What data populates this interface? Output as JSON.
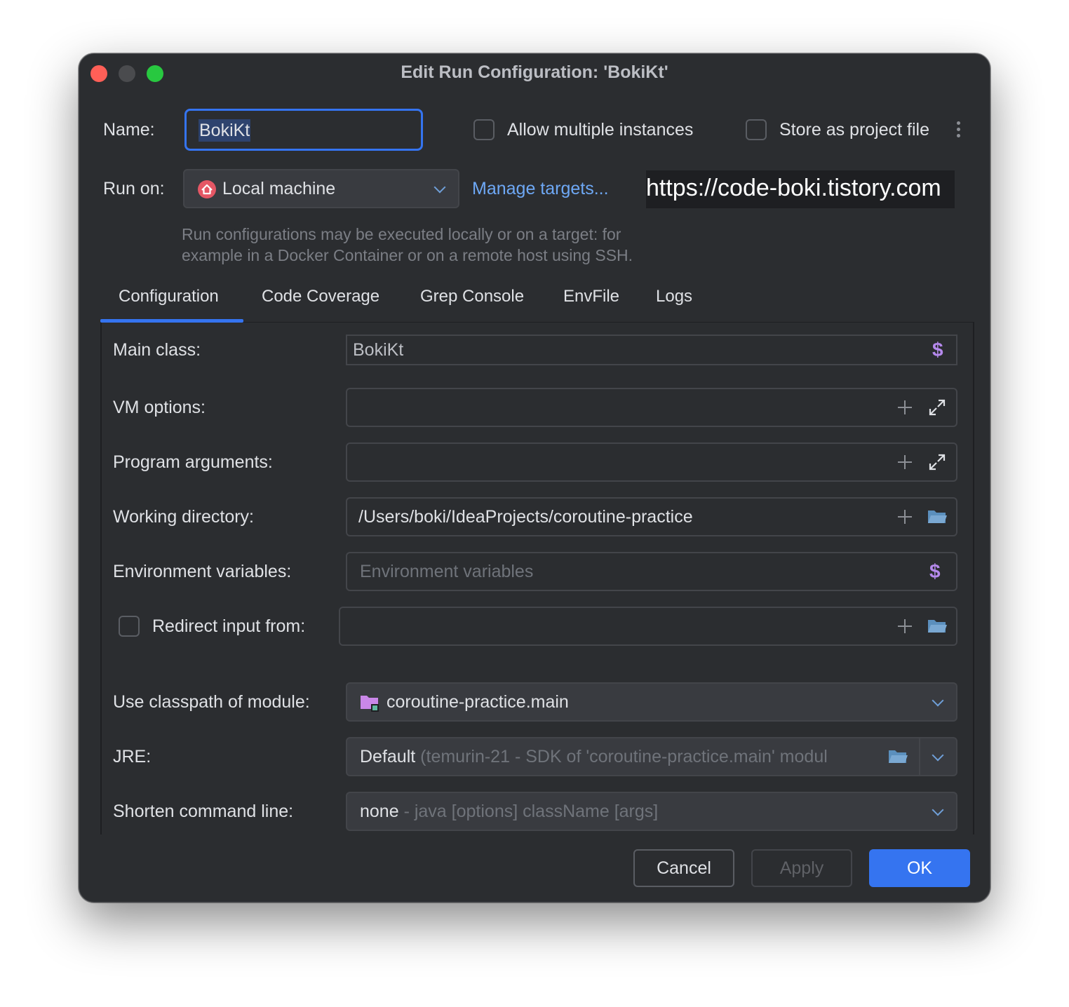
{
  "window": {
    "title": "Edit Run Configuration: 'BokiKt'"
  },
  "header": {
    "name_label": "Name:",
    "name_value": "BokiKt",
    "allow_multiple_label": "Allow multiple instances",
    "store_project_label": "Store as project file",
    "run_on_label": "Run on:",
    "run_on_value": "Local machine",
    "manage_targets_link": "Manage targets...",
    "watermark": "https://code-boki.tistory.com",
    "hint_line1": "Run configurations may be executed locally or on a target: for",
    "hint_line2": "example in a Docker Container or on a remote host using SSH."
  },
  "tabs": [
    {
      "label": "Configuration",
      "active": true
    },
    {
      "label": "Code Coverage"
    },
    {
      "label": "Grep Console"
    },
    {
      "label": "EnvFile"
    },
    {
      "label": "Logs"
    }
  ],
  "config": {
    "main_class_label": "Main class:",
    "main_class_value": "BokiKt",
    "vm_options_label": "VM options:",
    "program_args_label": "Program arguments:",
    "working_dir_label": "Working directory:",
    "working_dir_value": "/Users/boki/IdeaProjects/coroutine-practice",
    "env_vars_label": "Environment variables:",
    "env_vars_placeholder": "Environment variables",
    "redirect_input_label": "Redirect input from:",
    "classpath_label": "Use classpath of module:",
    "classpath_value": "coroutine-practice.main",
    "jre_label": "JRE:",
    "jre_value_main": "Default",
    "jre_value_detail": "(temurin-21 - SDK of 'coroutine-practice.main' modul",
    "shorten_label": "Shorten command line:",
    "shorten_value_main": "none",
    "shorten_value_detail": "- java [options] className [args]"
  },
  "footer": {
    "cancel_label": "Cancel",
    "apply_label": "Apply",
    "ok_label": "OK"
  },
  "colors": {
    "accent": "#3574f0",
    "link": "#6ea8f5",
    "background": "#2b2d30",
    "macro_icon": "#b589ec"
  }
}
